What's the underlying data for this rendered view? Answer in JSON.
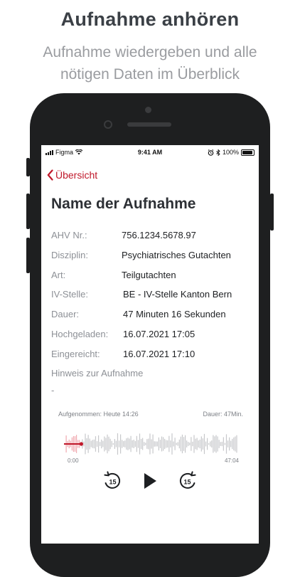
{
  "promo": {
    "title": "Aufnahme anhören",
    "subtitle_line1": "Aufnahme wiedergeben und alle",
    "subtitle_line2": "nötigen Daten im Überblick"
  },
  "status_bar": {
    "carrier": "Figma",
    "time": "9:41 AM",
    "battery": "100%"
  },
  "nav": {
    "back_label": "Übersicht"
  },
  "recording": {
    "title": "Name der Aufnahme",
    "fields": [
      {
        "label": "AHV Nr.:",
        "value": "756.1234.5678.97"
      },
      {
        "label": "Disziplin:",
        "value": "Psychiatrisches Gutachten"
      },
      {
        "label": "Art:",
        "value": "Teilgutachten"
      },
      {
        "label": "IV-Stelle:",
        "value": "BE - IV-Stelle Kanton Bern"
      },
      {
        "label": "Dauer:",
        "value": "47 Minuten 16 Sekunden"
      },
      {
        "label": "Hochgeladen:",
        "value": "16.07.2021 17:05"
      },
      {
        "label": "Eingereicht:",
        "value": "16.07.2021 17:10"
      }
    ],
    "note_label": "Hinweis zur Aufnahme",
    "note_value": "-"
  },
  "player": {
    "recorded_label": "Aufgenommen: Heute 14:26",
    "duration_label": "Dauer: 47Min.",
    "time_start": "0:00",
    "time_end": "47:04",
    "progress": 0.1,
    "skip_back_seconds": "15",
    "skip_forward_seconds": "15",
    "accent_color": "#c0182a"
  },
  "colors": {
    "accent": "#c0182a",
    "phone_frame": "#1e1f20",
    "title_text": "#3b4046"
  }
}
